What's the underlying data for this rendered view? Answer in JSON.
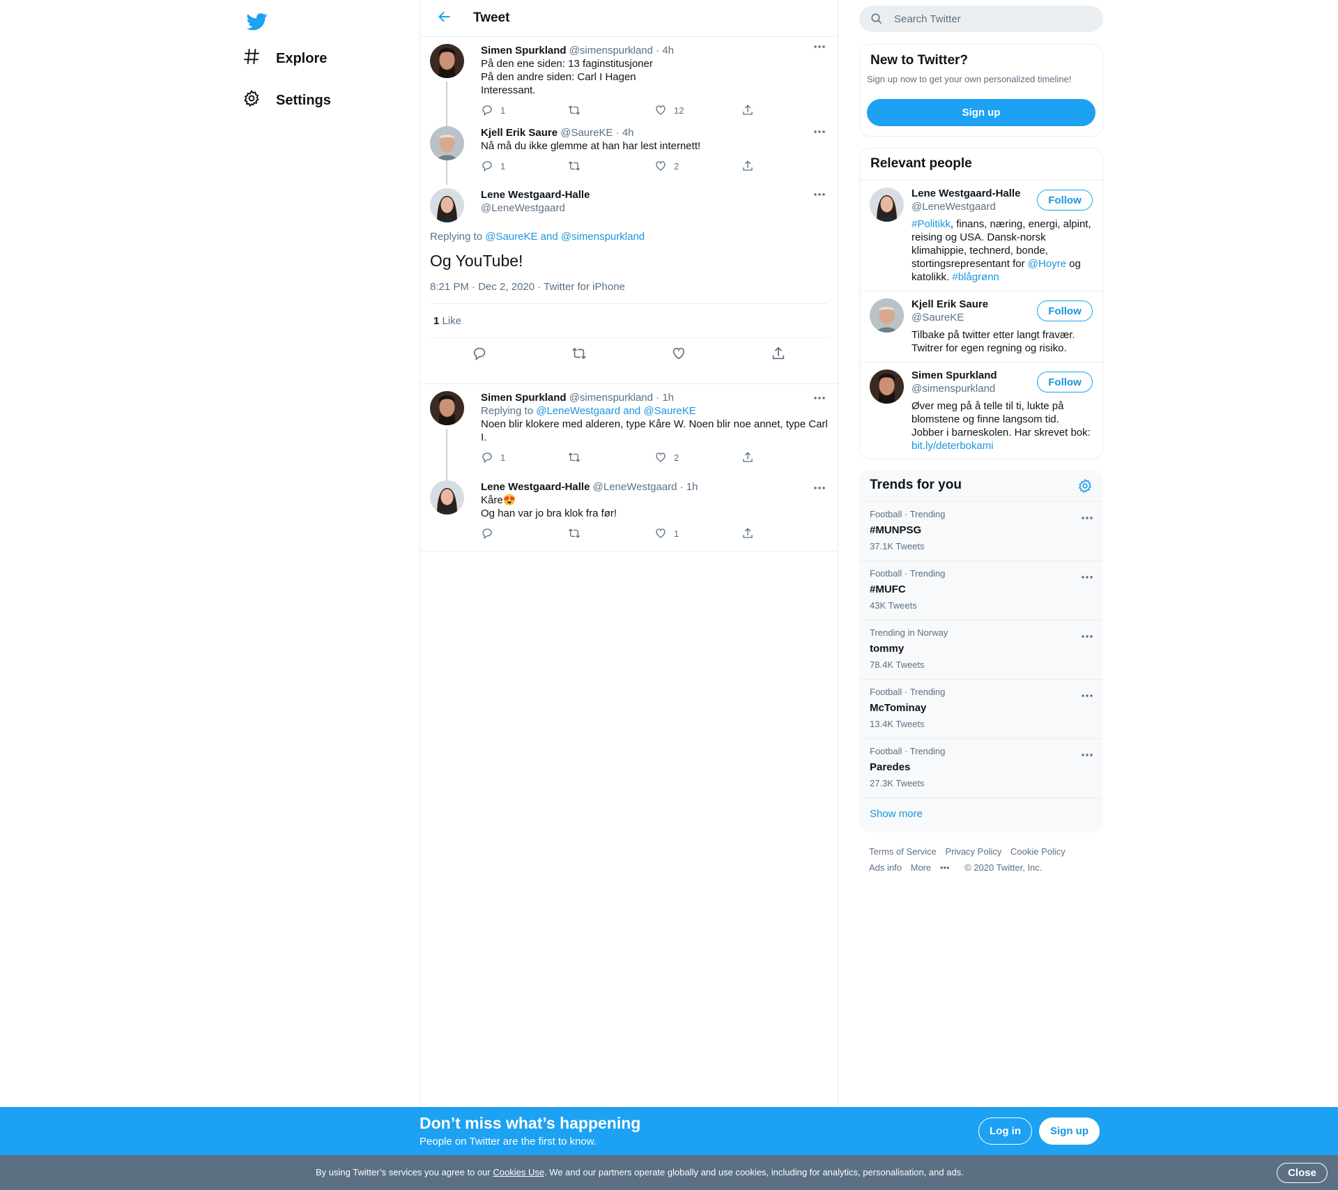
{
  "nav": {
    "logo_icon": "twitter-bird-icon",
    "items": [
      {
        "label": "Explore",
        "icon": "hashtag-icon"
      },
      {
        "label": "Settings",
        "icon": "gear-icon"
      }
    ]
  },
  "header": {
    "title": "Tweet",
    "back_icon": "arrow-left-icon"
  },
  "thread": [
    {
      "name": "Simen Spurkland",
      "handle": "@simenspurkland",
      "time": "4h",
      "lines": [
        "På den ene siden: 13 faginstitusjoner",
        "På den andre siden: Carl I Hagen",
        "Interessant."
      ],
      "replies": "1",
      "retweets": "",
      "likes": "12"
    },
    {
      "name": "Kjell Erik Saure",
      "handle": "@SaureKE",
      "time": "4h",
      "lines": [
        "Nå må du ikke glemme at han har lest internett!"
      ],
      "replies": "1",
      "retweets": "",
      "likes": "2"
    }
  ],
  "main_tweet": {
    "name": "Lene Westgaard-Halle",
    "handle": "@LeneWestgaard",
    "replying_prefix": "Replying to",
    "replying_to": "@SaureKE and @simenspurkland",
    "text": "Og YouTube!",
    "time": "8:21 PM",
    "date": "Dec 2, 2020",
    "source": "Twitter for iPhone",
    "like_count": "1",
    "like_label": "Like"
  },
  "replies": [
    {
      "name": "Simen Spurkland",
      "handle": "@simenspurkland",
      "time": "1h",
      "replying_prefix": "Replying to",
      "replying_to": "@LeneWestgaard and @SaureKE",
      "lines": [
        "Noen blir klokere med alderen, type Kåre W. Noen blir noe annet, type Carl I."
      ],
      "replies": "1",
      "retweets": "",
      "likes": "2"
    },
    {
      "name": "Lene Westgaard-Halle",
      "handle": "@LeneWestgaard",
      "time": "1h",
      "lines": [
        "Kåre😍",
        "Og han var jo bra klok fra før!"
      ],
      "replies": "",
      "retweets": "",
      "likes": "1"
    }
  ],
  "search": {
    "placeholder": "Search Twitter"
  },
  "new_to_twitter": {
    "title": "New to Twitter?",
    "subtitle": "Sign up now to get your own personalized timeline!",
    "button": "Sign up"
  },
  "relevant_people": {
    "title": "Relevant people",
    "follow_label": "Follow",
    "people": [
      {
        "name": "Lene Westgaard-Halle",
        "handle": "@LeneWestgaard",
        "bio_parts": [
          {
            "t": "#Politikk",
            "link": true
          },
          {
            "t": ", finans, næring, energi, alpint, reising og USA. Dansk-norsk klimahippie, technerd, bonde, stortingsrepresentant for ",
            "link": false
          },
          {
            "t": "@Hoyre",
            "link": true
          },
          {
            "t": " og katolikk. ",
            "link": false
          },
          {
            "t": "#blågrønn",
            "link": true
          }
        ]
      },
      {
        "name": "Kjell Erik Saure",
        "handle": "@SaureKE",
        "bio_parts": [
          {
            "t": "Tilbake på twitter etter langt fravær. Twitrer for egen regning og risiko.",
            "link": false
          }
        ]
      },
      {
        "name": "Simen Spurkland",
        "handle": "@simenspurkland",
        "bio_parts": [
          {
            "t": "Øver meg på å telle til ti, lukte på blomstene og finne langsom tid. Jobber i barneskolen. Har skrevet bok: ",
            "link": false
          },
          {
            "t": "bit.ly/deterbokami",
            "link": true
          }
        ]
      }
    ]
  },
  "trends": {
    "title": "Trends for you",
    "items": [
      {
        "meta": "Football · Trending",
        "name": "#MUNPSG",
        "count": "37.1K Tweets"
      },
      {
        "meta": "Football · Trending",
        "name": "#MUFC",
        "count": "43K Tweets"
      },
      {
        "meta": "Trending in Norway",
        "name": "tommy",
        "count": "78.4K Tweets"
      },
      {
        "meta": "Football · Trending",
        "name": "McTominay",
        "count": "13.4K Tweets"
      },
      {
        "meta": "Football · Trending",
        "name": "Paredes",
        "count": "27.3K Tweets"
      }
    ],
    "show_more": "Show more"
  },
  "footer": {
    "links_row1": [
      "Terms of Service",
      "Privacy Policy",
      "Cookie Policy"
    ],
    "ads_info": "Ads info",
    "more": "More",
    "copyright": "© 2020 Twitter, Inc."
  },
  "banner": {
    "title": "Don’t miss what’s happening",
    "subtitle": "People on Twitter are the first to know.",
    "login": "Log in",
    "signup": "Sign up"
  },
  "cookies": {
    "prefix": "By using Twitter’s services you agree to our ",
    "link": "Cookies Use",
    "suffix": ". We and our partners operate globally and use cookies, including for analytics, personalisation, and ads.",
    "close": "Close"
  },
  "colors": {
    "accent": "#1da1f2",
    "link": "#1b95e0",
    "muted": "#5b7083",
    "banner": "#1da1f2",
    "cookie_bar": "#5b7083"
  }
}
